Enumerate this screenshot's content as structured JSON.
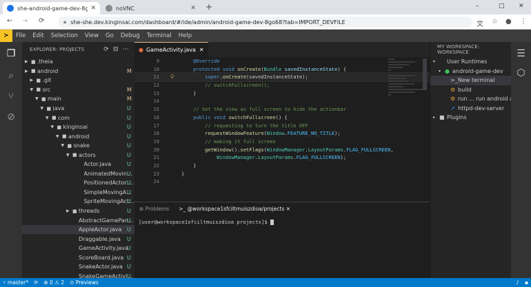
{
  "browser": {
    "tabs": [
      {
        "title": "she-android-game-dev-8go6",
        "active": true,
        "fav_color": "#1a73e8"
      },
      {
        "title": "noVNC",
        "active": false,
        "fav_color": "#888"
      }
    ],
    "url": "she-she.dev.kinginsai.com/dashboard/#/ide/admin/android-game-dev-8go68?tab=IMPORT_DEVFILE",
    "window_controls": [
      "–",
      "□",
      "✕"
    ],
    "nav": [
      "←",
      "→",
      "⟳"
    ]
  },
  "menu": {
    "logo": "≻",
    "items": [
      "File",
      "Edit",
      "Selection",
      "View",
      "Go",
      "Debug",
      "Terminal",
      "Help"
    ]
  },
  "explorer": {
    "title": "EXPLORER: PROJECTS",
    "tree": [
      {
        "name": ".theia",
        "depth": 0,
        "type": "folder",
        "open": false,
        "status": ""
      },
      {
        "name": "android",
        "depth": 0,
        "type": "folder",
        "open": false,
        "status": "M"
      },
      {
        "name": ".git",
        "depth": 1,
        "type": "folder",
        "open": false,
        "status": ""
      },
      {
        "name": "src",
        "depth": 1,
        "type": "folder",
        "open": true,
        "status": "M"
      },
      {
        "name": "main",
        "depth": 2,
        "type": "folder",
        "open": true,
        "status": "M"
      },
      {
        "name": "java",
        "depth": 3,
        "type": "folder",
        "open": true,
        "status": "U"
      },
      {
        "name": "com",
        "depth": 4,
        "type": "folder",
        "open": true,
        "status": "U"
      },
      {
        "name": "kinginsai",
        "depth": 5,
        "type": "folder",
        "open": true,
        "status": "U"
      },
      {
        "name": "android",
        "depth": 6,
        "type": "folder",
        "open": true,
        "status": "U"
      },
      {
        "name": "snake",
        "depth": 7,
        "type": "folder",
        "open": true,
        "status": "U"
      },
      {
        "name": "actors",
        "depth": 8,
        "type": "folder",
        "open": true,
        "status": "U"
      },
      {
        "name": "Actor.java",
        "depth": 9,
        "type": "file",
        "status": "U"
      },
      {
        "name": "AnimatedMovingActor.java",
        "depth": 9,
        "type": "file",
        "status": "U"
      },
      {
        "name": "PositionedActor.java",
        "depth": 9,
        "type": "file",
        "status": "U"
      },
      {
        "name": "SimpleMovingActor.java",
        "depth": 9,
        "type": "file",
        "status": "U"
      },
      {
        "name": "SpriteMovingActor.java",
        "depth": 9,
        "type": "file",
        "status": "U"
      },
      {
        "name": "threads",
        "depth": 8,
        "type": "folder",
        "open": false,
        "status": "U"
      },
      {
        "name": "AbstractGamePanel.java",
        "depth": 8,
        "type": "file",
        "status": "U"
      },
      {
        "name": "AppleActor.java",
        "depth": 8,
        "type": "file",
        "status": "U",
        "selected": true
      },
      {
        "name": "Draggable.java",
        "depth": 8,
        "type": "file",
        "status": "U"
      },
      {
        "name": "GameActivity.java",
        "depth": 8,
        "type": "file",
        "status": "U"
      },
      {
        "name": "ScoreBoard.java",
        "depth": 8,
        "type": "file",
        "status": "U"
      },
      {
        "name": "SnakeActor.java",
        "depth": 8,
        "type": "file",
        "status": "U"
      },
      {
        "name": "SnakeGameActivity.java",
        "depth": 8,
        "type": "file",
        "status": "U"
      }
    ]
  },
  "editor": {
    "tab": "GameActivity.java",
    "lines": [
      {
        "n": "9",
        "segs": [
          [
            "    ",
            ""
          ],
          [
            "@Override",
            "an"
          ]
        ]
      },
      {
        "n": "10",
        "segs": [
          [
            "    ",
            ""
          ],
          [
            "protected void ",
            "kw"
          ],
          [
            "onCreate",
            "fn"
          ],
          [
            "(",
            ""
          ],
          [
            "Bundle ",
            "ty"
          ],
          [
            "savedInstanceState",
            "pa"
          ],
          [
            ") {",
            ""
          ]
        ]
      },
      {
        "n": "11",
        "cur": true,
        "bulb": true,
        "segs": [
          [
            "        ",
            ""
          ],
          [
            "super",
            "kw"
          ],
          [
            ".",
            ""
          ],
          [
            "onCreate",
            "fn"
          ],
          [
            "(savedInstanceState);",
            ""
          ]
        ]
      },
      {
        "n": "12",
        "segs": [
          [
            "        ",
            ""
          ],
          [
            "// switchFullscreen();",
            "cm"
          ]
        ]
      },
      {
        "n": "13",
        "segs": [
          [
            "    }",
            ""
          ]
        ]
      },
      {
        "n": "14",
        "segs": [
          [
            "",
            ""
          ]
        ]
      },
      {
        "n": "15",
        "segs": [
          [
            "    ",
            ""
          ],
          [
            "// Set the view as full screen to hide the actionbar",
            "cm"
          ]
        ]
      },
      {
        "n": "16",
        "segs": [
          [
            "    ",
            ""
          ],
          [
            "public void ",
            "kw"
          ],
          [
            "switchFullscreen",
            "fn"
          ],
          [
            "() {",
            ""
          ]
        ]
      },
      {
        "n": "17",
        "segs": [
          [
            "        ",
            ""
          ],
          [
            "// requesting to turn the title OFF",
            "cm"
          ]
        ]
      },
      {
        "n": "18",
        "segs": [
          [
            "        ",
            ""
          ],
          [
            "requestWindowFeature",
            "fn"
          ],
          [
            "(",
            ""
          ],
          [
            "Window",
            "ty"
          ],
          [
            ".",
            ""
          ],
          [
            "FEATURE_NO_TITLE",
            "co"
          ],
          [
            ");",
            ""
          ]
        ]
      },
      {
        "n": "19",
        "segs": [
          [
            "        ",
            ""
          ],
          [
            "// making it full screen",
            "cm"
          ]
        ]
      },
      {
        "n": "20",
        "segs": [
          [
            "        ",
            ""
          ],
          [
            "getWindow",
            "fn"
          ],
          [
            "().",
            ""
          ],
          [
            "setFlags",
            "fn"
          ],
          [
            "(",
            ""
          ],
          [
            "WindowManager",
            "ty"
          ],
          [
            ".",
            ""
          ],
          [
            "LayoutParams",
            "ty"
          ],
          [
            ".",
            ""
          ],
          [
            "FLAG_FULLSCREEN",
            "co"
          ],
          [
            ",",
            ""
          ]
        ]
      },
      {
        "n": "21",
        "segs": [
          [
            "            ",
            ""
          ],
          [
            "WindowManager",
            "ty"
          ],
          [
            ".",
            ""
          ],
          [
            "LayoutParams",
            "ty"
          ],
          [
            ".",
            ""
          ],
          [
            "FLAG_FULLSCREEN",
            "co"
          ],
          [
            ");",
            ""
          ]
        ]
      },
      {
        "n": "22",
        "segs": [
          [
            "    }",
            ""
          ]
        ]
      },
      {
        "n": "23",
        "segs": [
          [
            "}",
            ""
          ]
        ]
      },
      {
        "n": "24",
        "segs": [
          [
            "",
            ""
          ]
        ]
      }
    ]
  },
  "terminal": {
    "tabs": [
      "Problems",
      "@workspace1sfciltmuiszdioa/projects"
    ],
    "prompt": "[user@workspace1sfciltmuiszdioa projects]$ "
  },
  "workspace": {
    "title": "MY WORKSPACE: WORKSPACE",
    "items": [
      {
        "label": "User Runtimes",
        "depth": 0,
        "twisty": "▾",
        "icon": "",
        "color": "#c5c5c5"
      },
      {
        "label": "android-game-dev",
        "depth": 1,
        "twisty": "▾",
        "icon": "●",
        "color": "#3dc553"
      },
      {
        "label": "New terminal",
        "depth": 2,
        "twisty": "",
        "icon": ">_",
        "color": "#ccc",
        "selected": true
      },
      {
        "label": "build",
        "depth": 2,
        "twisty": "",
        "icon": "⚙",
        "color": "#e8a33d"
      },
      {
        "label": "run ... run android app",
        "depth": 2,
        "twisty": "",
        "icon": "⚙",
        "color": "#e8a33d"
      },
      {
        "label": "httpd-dev-server",
        "depth": 2,
        "twisty": "",
        "icon": "↗",
        "color": "#3794ff"
      },
      {
        "label": "Plugins",
        "depth": 0,
        "twisty": "▸",
        "icon": "■",
        "color": "#c5c5c5"
      }
    ]
  },
  "statusbar": {
    "branch": "master*",
    "sync": "⟳",
    "problems": "⊗ 0 ⚠ 2",
    "previews": "Previews",
    "bell": "🔔"
  }
}
